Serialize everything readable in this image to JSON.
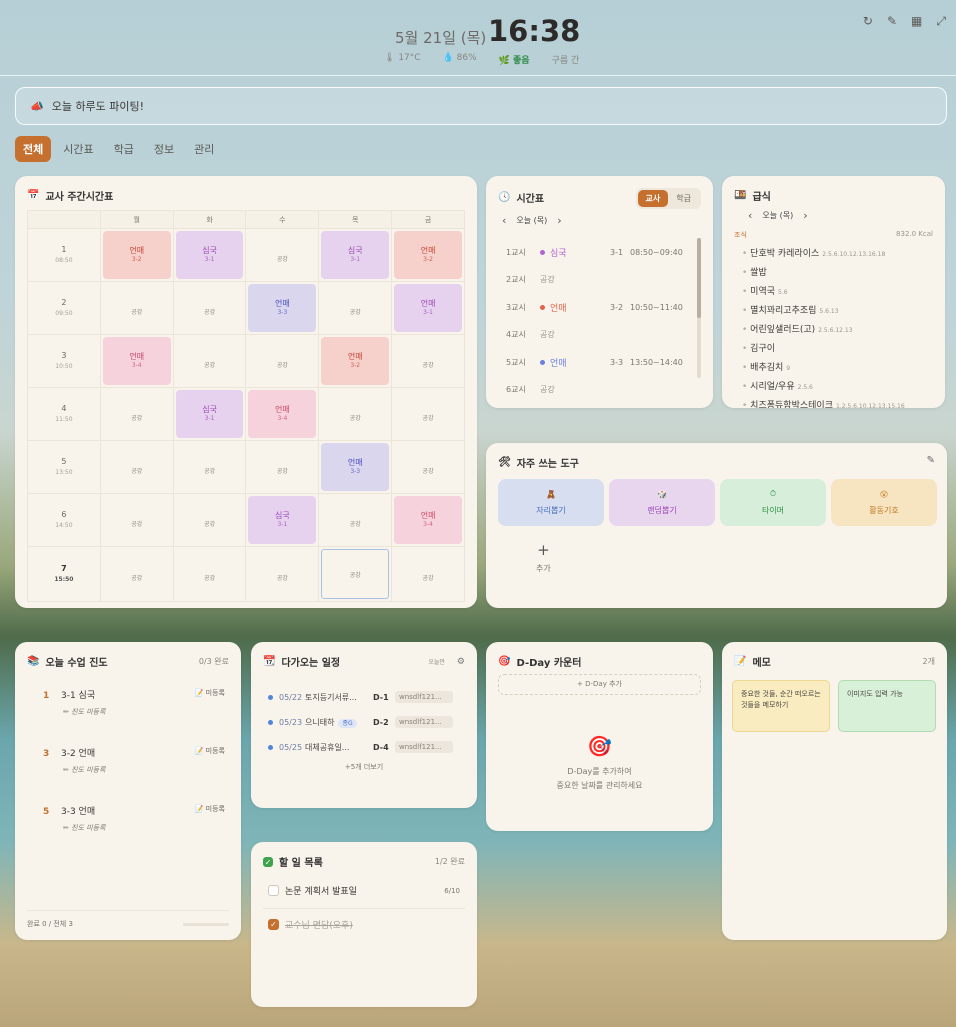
{
  "header": {
    "date": "5월 21일 (목)",
    "time": "16:38",
    "temp": "17°C",
    "humidity": "86%",
    "air": "좋음",
    "weather": "구름 간"
  },
  "motto": "오늘 하루도 파이팅!",
  "tabs": [
    "전체",
    "시간표",
    "학급",
    "정보",
    "관리"
  ],
  "weekly": {
    "title": "교사 주간시간표",
    "days": [
      "월",
      "화",
      "수",
      "목",
      "금"
    ],
    "periods": [
      {
        "n": "1",
        "t": "08:50"
      },
      {
        "n": "2",
        "t": "09:50"
      },
      {
        "n": "3",
        "t": "10:50"
      },
      {
        "n": "4",
        "t": "11:50"
      },
      {
        "n": "5",
        "t": "13:50"
      },
      {
        "n": "6",
        "t": "14:50"
      },
      {
        "n": "7",
        "t": "15:50"
      }
    ],
    "free": "공강",
    "grid": [
      [
        {
          "s": "언매",
          "c": "3-2",
          "k": "red"
        },
        {
          "s": "심국",
          "c": "3-1",
          "k": "pur"
        },
        null,
        {
          "s": "심국",
          "c": "3-1",
          "k": "pur"
        },
        {
          "s": "언매",
          "c": "3-2",
          "k": "red"
        }
      ],
      [
        null,
        null,
        {
          "s": "언매",
          "c": "3-3",
          "k": "blu"
        },
        null,
        {
          "s": "언매",
          "c": "3-1",
          "k": "pur"
        }
      ],
      [
        {
          "s": "언매",
          "c": "3-4",
          "k": "pnk"
        },
        null,
        null,
        {
          "s": "언매",
          "c": "3-2",
          "k": "red"
        },
        null
      ],
      [
        null,
        {
          "s": "심국",
          "c": "3-1",
          "k": "pur"
        },
        {
          "s": "언매",
          "c": "3-4",
          "k": "pnk"
        },
        null,
        null
      ],
      [
        null,
        null,
        null,
        {
          "s": "언매",
          "c": "3-3",
          "k": "blu"
        },
        null
      ],
      [
        null,
        null,
        {
          "s": "심국",
          "c": "3-1",
          "k": "pur"
        },
        null,
        {
          "s": "언매",
          "c": "3-4",
          "k": "pnk"
        }
      ],
      [
        null,
        null,
        null,
        "now",
        null
      ]
    ]
  },
  "schedule": {
    "title": "시간표",
    "toggle": [
      "교사",
      "학급"
    ],
    "nav": "오늘 (목)",
    "rows": [
      {
        "p": "1교시",
        "s": "심국",
        "room": "3-1",
        "time": "08:50~09:40",
        "color": "#b163d0"
      },
      {
        "p": "2교시",
        "s": "공강",
        "room": "",
        "time": "",
        "color": ""
      },
      {
        "p": "3교시",
        "s": "언매",
        "room": "3-2",
        "time": "10:50~11:40",
        "color": "#e0624c"
      },
      {
        "p": "4교시",
        "s": "공강",
        "room": "",
        "time": "",
        "color": ""
      },
      {
        "p": "5교시",
        "s": "언매",
        "room": "3-3",
        "time": "13:50~14:40",
        "color": "#6b7fdc"
      },
      {
        "p": "6교시",
        "s": "공강",
        "room": "",
        "time": "",
        "color": ""
      }
    ]
  },
  "meal": {
    "title": "급식",
    "nav": "오늘 (목)",
    "type": "조식",
    "kcal": "832.0 Kcal",
    "items": [
      {
        "n": "단호박 카레라이스",
        "a": "2.5.6.10.12.13.16.18"
      },
      {
        "n": "쌀밥",
        "a": ""
      },
      {
        "n": "미역국",
        "a": "5.6"
      },
      {
        "n": "멸치꽈리고추조림",
        "a": "5.6.13"
      },
      {
        "n": "어린잎샐러드(고)",
        "a": "2.5.6.12.13"
      },
      {
        "n": "김구이",
        "a": ""
      },
      {
        "n": "배추김치",
        "a": "9"
      },
      {
        "n": "시리얼/우유",
        "a": "2.5.6"
      },
      {
        "n": "치즈퐁듀함박스테이크",
        "a": "1.2.5.6.10.12.13.15.16"
      },
      {
        "n": "카스테라",
        "a": "1.2.5.6"
      }
    ]
  },
  "tools": {
    "title": "자주 쓰는 도구",
    "items": [
      {
        "l": "자리뽑기",
        "i": "🧸",
        "bg": "#d6deef",
        "fg": "#4a6fbf"
      },
      {
        "l": "랜덤뽑기",
        "i": "🎲",
        "bg": "#e8d6ef",
        "fg": "#9b48b4"
      },
      {
        "l": "타이머",
        "i": "⏱",
        "bg": "#d7eedb",
        "fg": "#2e9148"
      },
      {
        "l": "활동기호",
        "i": "😲",
        "bg": "#f7e5c2",
        "fg": "#c27a22"
      }
    ],
    "add": "추가"
  },
  "progress": {
    "title": "오늘 수업 진도",
    "count": "0/3 완료",
    "status": "미등록",
    "sub": "진도 미등록",
    "rows": [
      {
        "n": "1",
        "l": "3-1 심국"
      },
      {
        "n": "3",
        "l": "3-2 언매"
      },
      {
        "n": "5",
        "l": "3-3 언매"
      }
    ],
    "footer": "완료 0 / 전체 3"
  },
  "events": {
    "title": "다가오는 일정",
    "btn": "오늘만",
    "more": "+5개 더보기",
    "rows": [
      {
        "d": "05/22",
        "t": "토지등기서류...",
        "badge": "",
        "dd": "D-1",
        "tag": "wnsdlf121..."
      },
      {
        "d": "05/23",
        "t": "으니태하",
        "badge": "종G",
        "dd": "D-2",
        "tag": "wnsdlf121..."
      },
      {
        "d": "05/25",
        "t": "대체공휴일...",
        "badge": "",
        "dd": "D-4",
        "tag": "wnsdlf121..."
      }
    ]
  },
  "dday": {
    "title": "D-Day 카운터",
    "add": "+ D-Day 추가",
    "empty1": "D-Day를 추가하여",
    "empty2": "중요한 날짜를 관리하세요"
  },
  "memo": {
    "title": "메모",
    "count": "2개",
    "notes": [
      {
        "t": "중요한 것들, 순간 떠오르는 것들을 메모하기",
        "bg": "#f8ecc0",
        "bd": "#eed88f"
      },
      {
        "t": "이미지도 입력 가능",
        "bg": "#d8efd8",
        "bd": "#b3dcb3"
      }
    ]
  },
  "todo": {
    "title": "할 일 목록",
    "count": "1/2 완료",
    "items": [
      {
        "t": "논문 계획서 발표일",
        "c": "6/10",
        "done": false
      },
      {
        "t": "교수님 면담(오후)",
        "c": "",
        "done": true
      }
    ]
  }
}
